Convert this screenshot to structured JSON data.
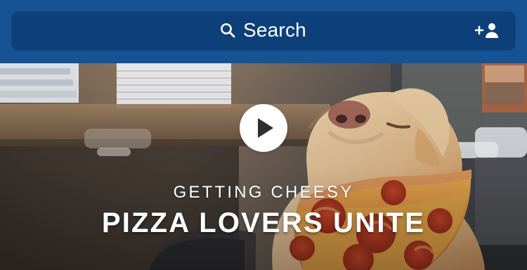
{
  "search": {
    "label": "Search"
  },
  "icons": {
    "search": "search-icon",
    "add_user": "add-person-icon",
    "play": "play-icon"
  },
  "hero": {
    "kicker": "GETTING CHEESY",
    "title": "PIZZA LOVERS UNITE"
  },
  "colors": {
    "topbar": "#165394",
    "search_box": "#0d3f78",
    "text": "#ffffff"
  }
}
